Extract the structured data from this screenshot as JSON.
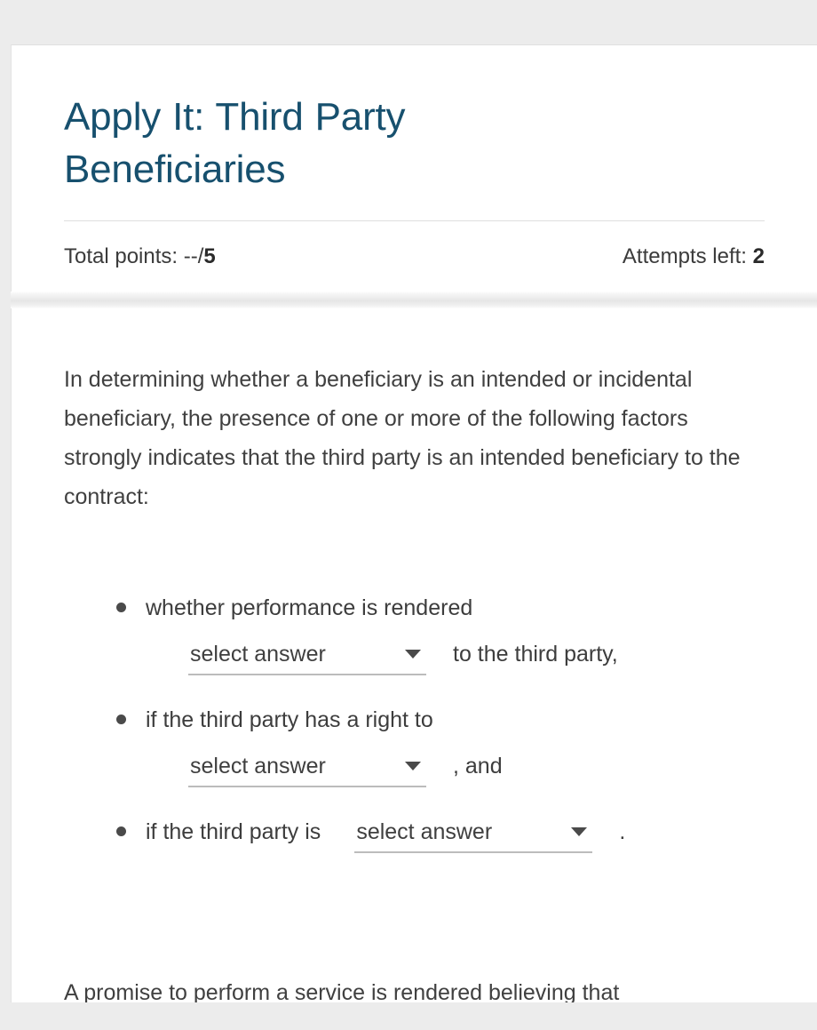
{
  "header": {
    "title": "Apply It: Third Party Beneficiaries",
    "total_points_label": "Total points: --/",
    "total_points_value": "5",
    "attempts_label": "Attempts left: ",
    "attempts_value": "2",
    "title_color": "#17506e"
  },
  "question": {
    "prompt": "In determining whether a beneficiary is an intended or incidental beneficiary, the presence of one or more of the following factors strongly indicates that the third party is an intended beneficiary to the contract:",
    "factors": [
      {
        "lead": "whether performance is rendered",
        "select_value": "select answer",
        "tail": "to the third party,"
      },
      {
        "lead": "if the third party has a right to",
        "select_value": "select answer",
        "tail": ", and"
      },
      {
        "lead": "if the third party is",
        "select_value": "select answer",
        "tail": "."
      }
    ],
    "trailing_text": "A promise to perform a service is rendered believing that"
  },
  "icons": {
    "caret": "chevron-down-icon",
    "bullet": "bullet-dot-icon"
  }
}
